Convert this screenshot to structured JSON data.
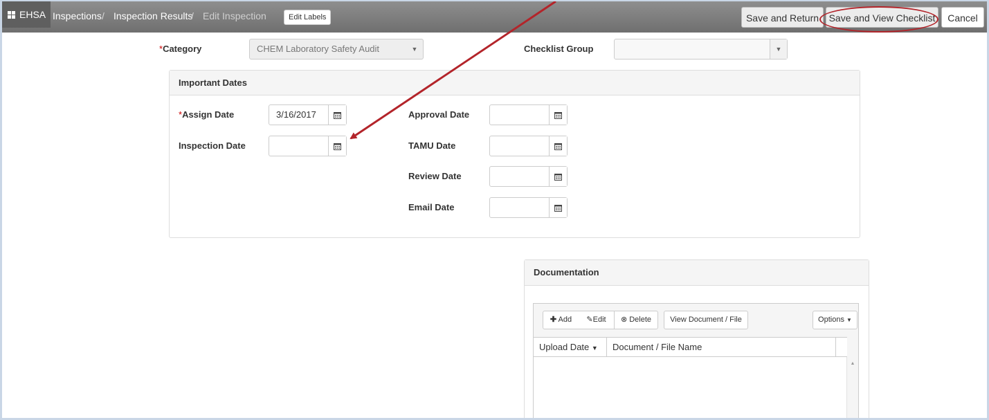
{
  "nav": {
    "brand": "EHSA",
    "breadcrumbs": [
      "Inspections",
      "Inspection Results",
      "Edit Inspection"
    ],
    "separator": "/",
    "edit_labels": "Edit Labels"
  },
  "actions": {
    "save_return": "Save and Return",
    "save_view_checklist": "Save and View Checklist",
    "cancel": "Cancel"
  },
  "form": {
    "required_mark": "*",
    "category_label": "Category",
    "category_value": "CHEM Laboratory Safety Audit",
    "checklist_group_label": "Checklist Group",
    "checklist_group_value": ""
  },
  "important_dates": {
    "title": "Important Dates",
    "assign_date_label": "Assign Date",
    "assign_date_value": "3/16/2017",
    "inspection_date_label": "Inspection Date",
    "approval_date_label": "Approval Date",
    "tamu_date_label": "TAMU Date",
    "review_date_label": "Review Date",
    "email_date_label": "Email Date"
  },
  "documentation": {
    "title": "Documentation",
    "add": "Add",
    "edit": "Edit",
    "delete": "Delete",
    "view": "View Document / File",
    "options": "Options",
    "columns": [
      "Upload Date",
      "Document / File Name"
    ]
  },
  "colors": {
    "annotation_red": "#b3242a",
    "topbar": "#7a7a7a"
  }
}
